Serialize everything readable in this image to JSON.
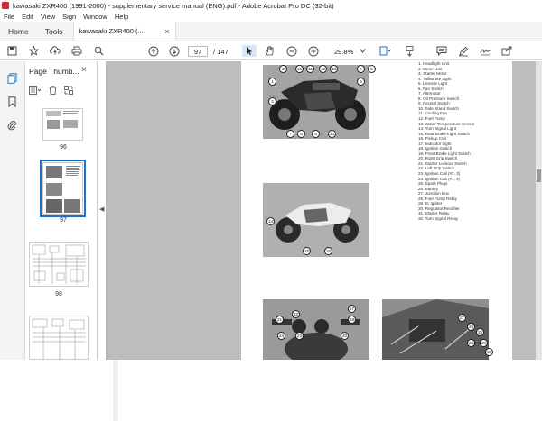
{
  "window": {
    "title": "kawasaki ZXR400 (1991-2000) - supplementary service manual (ENG).pdf - Adobe Acrobat Pro DC (32-bit)"
  },
  "menu": [
    "File",
    "Edit",
    "View",
    "Sign",
    "Window",
    "Help"
  ],
  "tabs": {
    "home": "Home",
    "tools": "Tools",
    "document": "kawasaki ZXR400 (...",
    "close": "×"
  },
  "toolbar": {
    "current_page": "97",
    "page_total": "/ 147",
    "zoom": "29.8%"
  },
  "panel": {
    "title": "Page Thumb...",
    "thumbnails": [
      {
        "label": "96"
      },
      {
        "label": "97"
      },
      {
        "label": "98"
      }
    ]
  },
  "page": {
    "legend": [
      "1. Headlight Unit",
      "2. Meter Unit",
      "3. Starter Motor",
      "4. Tail/Brake Light",
      "5. License Light",
      "6. Fan Switch",
      "7. Alternator",
      "8. Oil Pressure Switch",
      "9. Neutral Switch",
      "10. Side Stand Switch",
      "11. Cooling Fan",
      "12. Fuel Pump",
      "13. Water Temperature Sensor",
      "14. Turn Signal Light",
      "15. Rear Brake Light Switch",
      "16. Pickup Coil",
      "17. Indicator Light",
      "18. Ignition Switch",
      "19. Front Brake Light Switch",
      "20. Right Grip Switch",
      "21. Starter Lockout Switch",
      "22. Left Grip Switch",
      "23. Ignition Coil (#2, 3)",
      "24. Ignition Coil (#1, 4)",
      "25. Spark Plugs",
      "26. Battery",
      "27. Junction Box",
      "28. Fuel Pump Relay",
      "29. IC Igniter",
      "30. Regulator/Rectifier",
      "31. Starter Relay",
      "32. Turn Signal Relay"
    ],
    "callouts": {
      "photo1": [
        "1",
        "2",
        "10",
        "11",
        "12",
        "13",
        "4",
        "5",
        "6",
        "7",
        "8",
        "9",
        "10",
        "3"
      ],
      "photo2": [
        "14",
        "15",
        "16"
      ],
      "photo3": [
        "21",
        "22",
        "17",
        "18",
        "20",
        "24",
        "23"
      ],
      "photo4": [
        "27",
        "26",
        "25",
        "28",
        "29",
        "30"
      ]
    }
  },
  "colors": {
    "accent": "#1a73c9",
    "canvas": "#bdbdbd",
    "app_icon": "#d7282f"
  }
}
